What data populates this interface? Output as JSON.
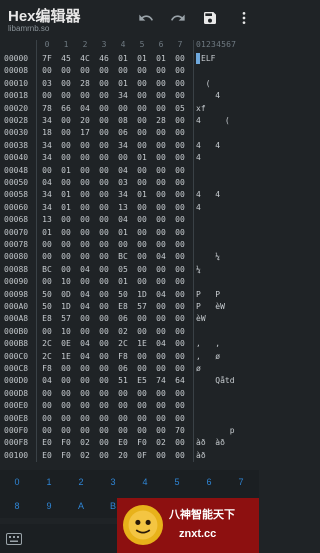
{
  "app": {
    "title": "Hex编辑器",
    "subtitle": "libamrnb.so"
  },
  "toolbar": {
    "undo_icon": "undo-icon",
    "redo_icon": "redo-icon",
    "save_icon": "save-icon",
    "more_icon": "more-vert-icon"
  },
  "header": {
    "cols": [
      "0",
      "1",
      "2",
      "3",
      "4",
      "5",
      "6",
      "7"
    ],
    "ascii": "01234567"
  },
  "rows": [
    {
      "off": "00000",
      "b": [
        "7F",
        "45",
        "4C",
        "46",
        "01",
        "01",
        "01",
        "00"
      ],
      "a": "ELF"
    },
    {
      "off": "00008",
      "b": [
        "00",
        "00",
        "00",
        "00",
        "00",
        "00",
        "00",
        "00"
      ],
      "a": ""
    },
    {
      "off": "00010",
      "b": [
        "03",
        "00",
        "28",
        "00",
        "01",
        "00",
        "00",
        "00"
      ],
      "a": "  ("
    },
    {
      "off": "00018",
      "b": [
        "00",
        "00",
        "00",
        "00",
        "34",
        "00",
        "00",
        "00"
      ],
      "a": "    4"
    },
    {
      "off": "00020",
      "b": [
        "78",
        "66",
        "04",
        "00",
        "00",
        "00",
        "00",
        "05"
      ],
      "a": "xf"
    },
    {
      "off": "00028",
      "b": [
        "34",
        "00",
        "20",
        "00",
        "08",
        "00",
        "28",
        "00"
      ],
      "a": "4     ("
    },
    {
      "off": "00030",
      "b": [
        "18",
        "00",
        "17",
        "00",
        "06",
        "00",
        "00",
        "00"
      ],
      "a": ""
    },
    {
      "off": "00038",
      "b": [
        "34",
        "00",
        "00",
        "00",
        "34",
        "00",
        "00",
        "00"
      ],
      "a": "4   4"
    },
    {
      "off": "00040",
      "b": [
        "34",
        "00",
        "00",
        "00",
        "00",
        "01",
        "00",
        "00"
      ],
      "a": "4"
    },
    {
      "off": "00048",
      "b": [
        "00",
        "01",
        "00",
        "00",
        "04",
        "00",
        "00",
        "00"
      ],
      "a": ""
    },
    {
      "off": "00050",
      "b": [
        "04",
        "00",
        "00",
        "00",
        "03",
        "00",
        "00",
        "00"
      ],
      "a": ""
    },
    {
      "off": "00058",
      "b": [
        "34",
        "01",
        "00",
        "00",
        "34",
        "01",
        "00",
        "00"
      ],
      "a": "4   4"
    },
    {
      "off": "00060",
      "b": [
        "34",
        "01",
        "00",
        "00",
        "13",
        "00",
        "00",
        "00"
      ],
      "a": "4"
    },
    {
      "off": "00068",
      "b": [
        "13",
        "00",
        "00",
        "00",
        "04",
        "00",
        "00",
        "00"
      ],
      "a": ""
    },
    {
      "off": "00070",
      "b": [
        "01",
        "00",
        "00",
        "00",
        "01",
        "00",
        "00",
        "00"
      ],
      "a": ""
    },
    {
      "off": "00078",
      "b": [
        "00",
        "00",
        "00",
        "00",
        "00",
        "00",
        "00",
        "00"
      ],
      "a": ""
    },
    {
      "off": "00080",
      "b": [
        "00",
        "00",
        "00",
        "00",
        "BC",
        "00",
        "04",
        "00"
      ],
      "a": "    ¼"
    },
    {
      "off": "00088",
      "b": [
        "BC",
        "00",
        "04",
        "00",
        "05",
        "00",
        "00",
        "00"
      ],
      "a": "¼"
    },
    {
      "off": "00090",
      "b": [
        "00",
        "10",
        "00",
        "00",
        "01",
        "00",
        "00",
        "00"
      ],
      "a": ""
    },
    {
      "off": "00098",
      "b": [
        "50",
        "0D",
        "04",
        "00",
        "50",
        "1D",
        "04",
        "00"
      ],
      "a": "P   P"
    },
    {
      "off": "000A0",
      "b": [
        "50",
        "1D",
        "04",
        "00",
        "E8",
        "57",
        "00",
        "00"
      ],
      "a": "P   èW"
    },
    {
      "off": "000A8",
      "b": [
        "E8",
        "57",
        "00",
        "00",
        "06",
        "00",
        "00",
        "00"
      ],
      "a": "èW"
    },
    {
      "off": "000B0",
      "b": [
        "00",
        "10",
        "00",
        "00",
        "02",
        "00",
        "00",
        "00"
      ],
      "a": ""
    },
    {
      "off": "000B8",
      "b": [
        "2C",
        "0E",
        "04",
        "00",
        "2C",
        "1E",
        "04",
        "00"
      ],
      "a": ",   ,"
    },
    {
      "off": "000C0",
      "b": [
        "2C",
        "1E",
        "04",
        "00",
        "F8",
        "00",
        "00",
        "00"
      ],
      "a": ",   ø"
    },
    {
      "off": "000C8",
      "b": [
        "F8",
        "00",
        "00",
        "00",
        "06",
        "00",
        "00",
        "00"
      ],
      "a": "ø"
    },
    {
      "off": "000D0",
      "b": [
        "04",
        "00",
        "00",
        "00",
        "51",
        "E5",
        "74",
        "64"
      ],
      "a": "    Qåtd"
    },
    {
      "off": "000D8",
      "b": [
        "00",
        "00",
        "00",
        "00",
        "00",
        "00",
        "00",
        "00"
      ],
      "a": ""
    },
    {
      "off": "000E0",
      "b": [
        "00",
        "00",
        "00",
        "00",
        "00",
        "00",
        "00",
        "00"
      ],
      "a": ""
    },
    {
      "off": "000E8",
      "b": [
        "00",
        "00",
        "00",
        "00",
        "00",
        "00",
        "00",
        "00"
      ],
      "a": ""
    },
    {
      "off": "000F0",
      "b": [
        "00",
        "00",
        "00",
        "00",
        "00",
        "00",
        "00",
        "70"
      ],
      "a": "       p"
    },
    {
      "off": "000F8",
      "b": [
        "E0",
        "F0",
        "02",
        "00",
        "E0",
        "F0",
        "02",
        "00"
      ],
      "a": "àð  àð"
    },
    {
      "off": "00100",
      "b": [
        "E0",
        "F0",
        "02",
        "00",
        "20",
        "0F",
        "00",
        "00"
      ],
      "a": "àð"
    }
  ],
  "keypad": {
    "row1": [
      "0",
      "1",
      "2",
      "3",
      "4",
      "5",
      "6",
      "7"
    ],
    "row2": [
      "8",
      "9",
      "A",
      "B"
    ]
  },
  "bottom": {
    "keyboard_icon": "keyboard-icon"
  },
  "ad": {
    "text": "八神智能天下",
    "url": "znxt.cc",
    "logo_icon": "mascot-logo-icon"
  },
  "colors": {
    "background": "#1f2326",
    "accent": "#2f86d6",
    "cursor": "#6fa8dc",
    "ad_background": "#8d1010"
  }
}
